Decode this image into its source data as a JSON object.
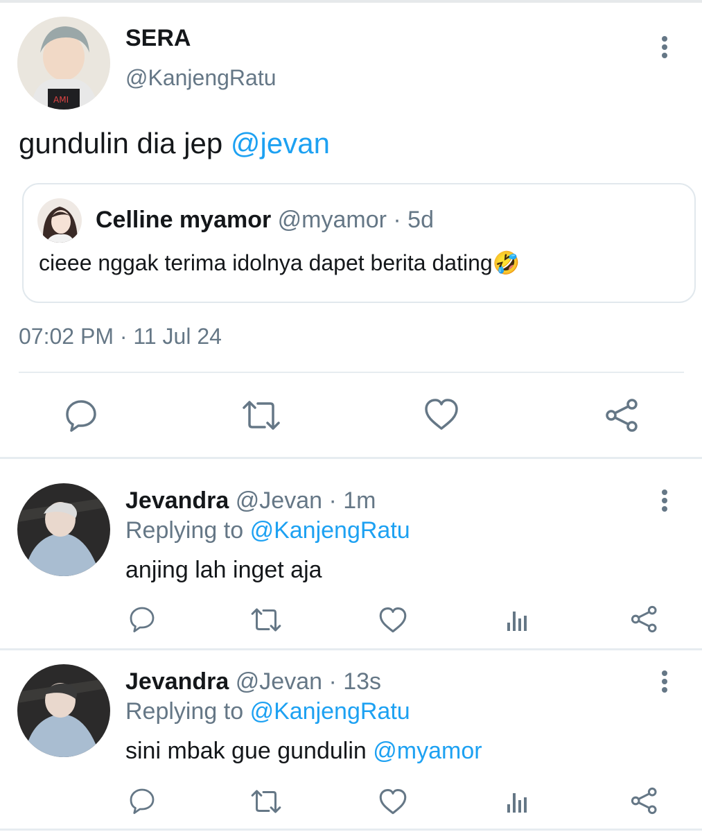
{
  "tweet": {
    "display_name": "SERA",
    "handle": "@KanjengRatu",
    "text": "gundulin dia jep",
    "mention": "@jevan",
    "timestamp": "07:02 PM · 11 Jul 24",
    "quoted": {
      "display_name": "Celline myamor",
      "handle_time": "@myamor · 5d",
      "text": "cieee nggak terima idolnya dapet berita dating",
      "emoji": "🤣"
    },
    "actions": [
      "reply-icon",
      "retweet-icon",
      "like-icon",
      "share-icon"
    ]
  },
  "replies": [
    {
      "display_name": "Jevandra",
      "handle_time": "@Jevan · 1m",
      "replying_prefix": "Replying to",
      "replying_to": "@KanjengRatu",
      "text": "anjing lah inget aja",
      "mention": ""
    },
    {
      "display_name": "Jevandra",
      "handle_time": "@Jevan · 13s",
      "replying_prefix": "Replying to",
      "replying_to": "@KanjengRatu",
      "text": "sini mbak gue gundulin",
      "mention": "@myamor"
    }
  ],
  "colors": {
    "link": "#1da1f2",
    "muted": "#657786",
    "divider": "#e6ecf0"
  }
}
